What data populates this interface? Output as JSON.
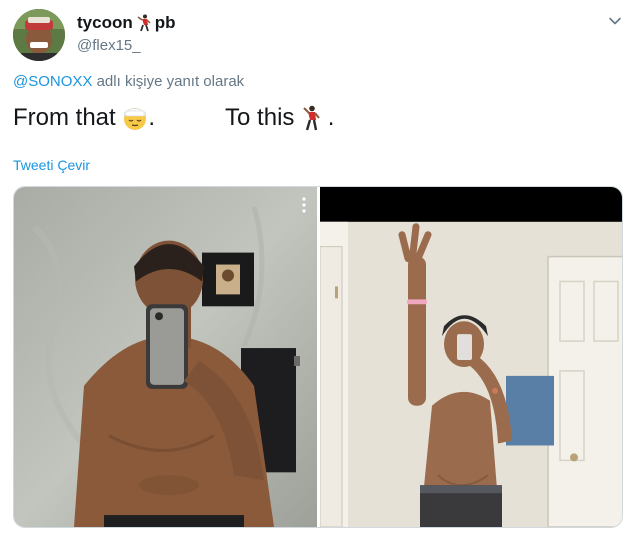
{
  "tweet": {
    "display_name": "tycoon",
    "name_suffix": "pb",
    "handle": "@flex15_",
    "reply_mention": "@SONOXX",
    "reply_text": " adlı kişiye yanıt olarak",
    "text_part1": "From that ",
    "text_part2": ".",
    "text_part3": "To this ",
    "text_part4": " .",
    "translate_label": "Tweeti Çevir"
  },
  "icons": {
    "name_emoji": "man-dancing-icon",
    "emoji_1": "face-with-head-bandage-icon",
    "emoji_2": "man-dancing-icon",
    "menu": "chevron-down-icon",
    "photo_menu": "more-vertical-icon"
  },
  "colors": {
    "link": "#1b95e0",
    "secondary_text": "#657786",
    "primary_text": "#14171a"
  }
}
